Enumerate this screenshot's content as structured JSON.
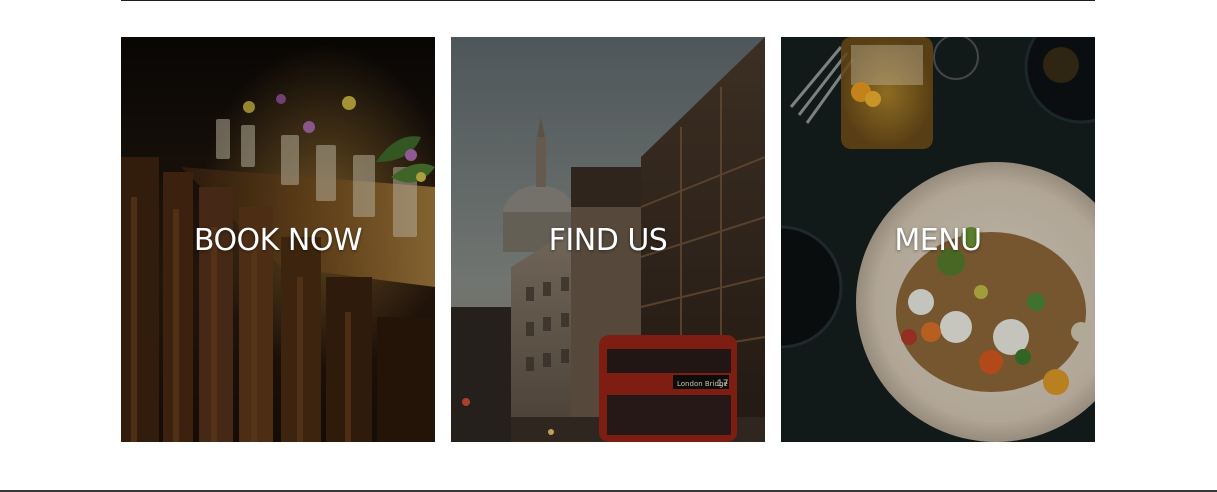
{
  "tiles": [
    {
      "label": "BOOK NOW",
      "image": "restaurant-table-photo"
    },
    {
      "label": "FIND US",
      "image": "london-street-photo"
    },
    {
      "label": "MENU",
      "image": "food-plate-photo"
    }
  ],
  "bus": {
    "destination": "London Bridge",
    "route": "17"
  }
}
